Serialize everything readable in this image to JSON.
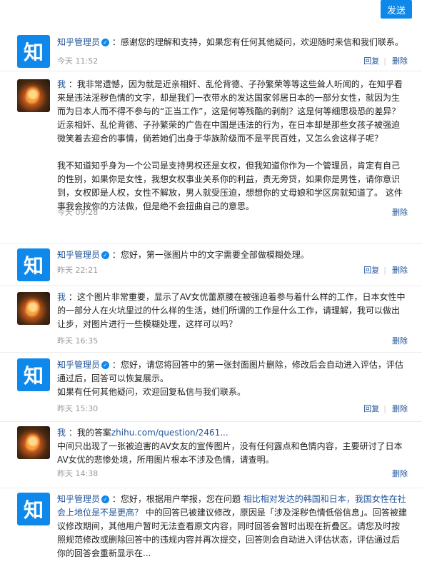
{
  "send_label": "发送",
  "admin_name": "知乎管理员",
  "me_name": "我",
  "zhi_char": "知",
  "actions": {
    "reply": "回复",
    "delete": "删除"
  },
  "messages": [
    {
      "text": "感谢您的理解和支持，如果您有任何其他疑问，欢迎随时来信和我们联系。",
      "time": "今天 11:52"
    },
    {
      "text": "我非常遗憾，因为就是近亲相奸、乱伦背德、子孙繁荣等等这些耸人听闻的，在知乎看来是违法淫秽色情的文字，却是我们一衣带水的发达国家邻居日本的一部分女性，就因为生而为日本人而不得不参与的“正当工作”，这是何等残酷的剥削？这是何等细思极恐的差异？近亲相奸、乱伦背德、子孙繁荣的广告在中国是违法的行为，在日本却是那些女孩子被强迫微笑着去迎合的事情，倘若她们出身于华族阶级而不是平民百姓，又怎么会这样子呢？",
      "text2": "我不知道知乎身为一个公司是支持男权还是女权，但我知道你作为一个管理员，肯定有自己的性别，如果你是女性，我想女权事业关系你的利益，责无旁贷，如果你是男性，请你意识到，女权即是人权，女性不解放，男人就受压迫，想想你的丈母娘和学区房就知道了。 这件事我会按你的方法做，但是绝不会扭曲自己的意思。",
      "time": "今天 09:28"
    },
    {
      "text": "您好，第一张图片中的文字需要全部做模糊处理。",
      "time": "昨天 22:21"
    },
    {
      "text": "这个图片非常重要，显示了AV女优蕾原腰在被强迫着参与着什么样的工作，日本女性中的一部分人在火坑里过的什么样的生活，她们所谓的工作是什么工作，请理解，我可以做出让步，对图片进行一些模糊处理，这样可以吗？",
      "time": "昨天 16:35"
    },
    {
      "text": "您好，请您将回答中的第一张封面图片删除，修改后会自动进入评估，评估通过后，回答可以恢复展示。",
      "text2": "如果有任何其他疑问，欢迎回复私信与我们联系。",
      "time": "昨天 15:30"
    },
    {
      "text_prefix": "我的答案",
      "link": "zhihu.com/question/2461...",
      "text2": "中间只出现了一张被迫害的AV女友的宣传图片，没有任何露点和色情内容，主要研讨了日本AV女优的悲惨处境，所用图片根本不涉及色情，请查明。",
      "time": "昨天 14:38"
    },
    {
      "text_prefix": "您好，根据用户举报，您在问题",
      "link": "相比相对发达的韩国和日本，我国女性在社会上地位是不是更高？",
      "text_suffix": "中的回答已被建议修改，原因是「涉及淫秽色情低俗信息」。回答被建议修改期间，其他用户暂时无法查看原文内容，同时回答会暂时出现在折叠区。请您及时按照规范修改或删除回答中的违规内容并再次提交，回答则会自动进入评估状态，评估通过后你的回答会重新显示在..."
    }
  ]
}
